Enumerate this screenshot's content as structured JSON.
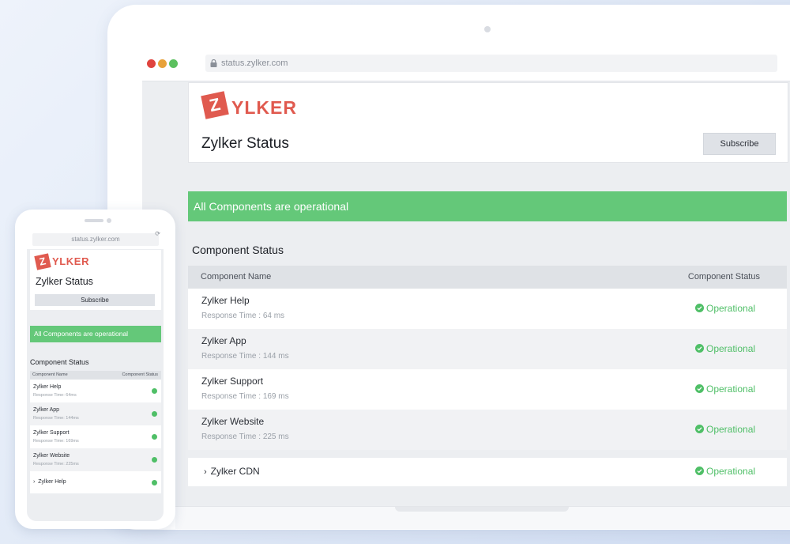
{
  "desktop": {
    "browser": {
      "url": "status.zylker.com"
    },
    "brand": {
      "logo_letter": "Z",
      "logo_text": "YLKER"
    },
    "page_title": "Zylker Status",
    "subscribe_label": "Subscribe",
    "banner": "All Components are operational",
    "section_title": "Component Status",
    "table": {
      "headers": {
        "name": "Component Name",
        "status": "Component Status"
      },
      "rows": [
        {
          "name": "Zylker Help",
          "response": "Response Time : 64 ms",
          "status": "Operational"
        },
        {
          "name": "Zylker App",
          "response": "Response Time : 144 ms",
          "status": "Operational"
        },
        {
          "name": "Zylker Support",
          "response": "Response Time : 169 ms",
          "status": "Operational"
        },
        {
          "name": "Zylker Website",
          "response": "Response Time : 225 ms",
          "status": "Operational"
        }
      ],
      "group_row": {
        "chevron": "›",
        "name": "Zylker CDN",
        "status": "Operational"
      }
    }
  },
  "mobile": {
    "browser": {
      "url": "status.zylker.com",
      "reload_icon": "⟳"
    },
    "brand": {
      "logo_letter": "Z",
      "logo_text": "YLKER"
    },
    "page_title": "Zylker Status",
    "subscribe_label": "Subscribe",
    "banner": "All Components are operational",
    "section_title": "Component Status",
    "table": {
      "headers": {
        "name": "Component Name",
        "status": "Component Status"
      },
      "rows": [
        {
          "name": "Zylker Help",
          "response": "Response Time: 64ms"
        },
        {
          "name": "Zylker App",
          "response": "Response Time: 144ms"
        },
        {
          "name": "Zylker Support",
          "response": "Response Time: 169ms"
        },
        {
          "name": "Zylker Website",
          "response": "Response Time: 225ms"
        }
      ],
      "group_row": {
        "chevron": "›",
        "name": "Zylker Help"
      }
    }
  },
  "colors": {
    "brand": "#e05a4f",
    "operational": "#4fbf67",
    "banner": "#64c879"
  }
}
